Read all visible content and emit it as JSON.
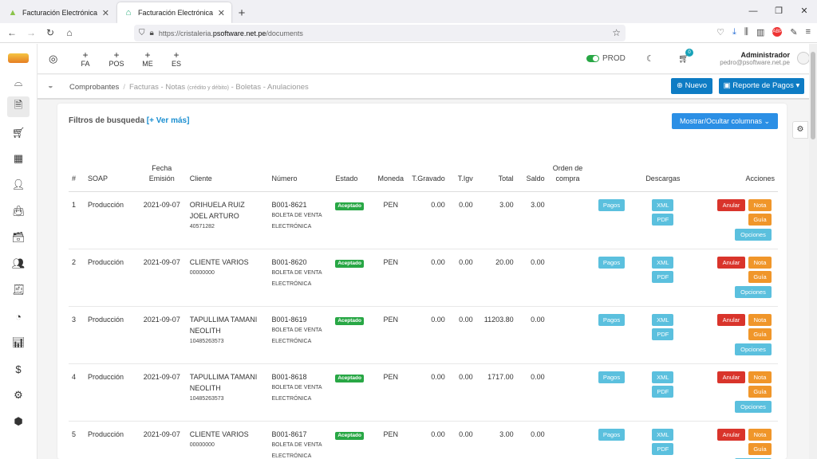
{
  "browser": {
    "tabs": [
      {
        "title": "Facturación Electrónica",
        "icon": "app-logo-icon",
        "active": false
      },
      {
        "title": "Facturación Electrónica",
        "icon": "app-logo-icon",
        "active": true
      }
    ],
    "url_prefix": "https://cristaleria.",
    "url_domain": "psoftware.net.pe",
    "url_path": "/documents"
  },
  "topbar": {
    "quick_actions": [
      {
        "plus": "+",
        "label": "FA"
      },
      {
        "plus": "+",
        "label": "POS"
      },
      {
        "plus": "+",
        "label": "ME"
      },
      {
        "plus": "+",
        "label": "ES"
      }
    ],
    "env_label": "PROD",
    "cart_count": "0",
    "user_name": "Administrador",
    "user_email": "pedro@psoftware.net.pe"
  },
  "breadcrumb": {
    "current": "Comprobantes",
    "sep": "/",
    "rest_a": "Facturas - Notas",
    "rest_small": "(crédito y débito)",
    "rest_b": "- Boletas - Anulaciones"
  },
  "buttons": {
    "nuevo": "Nuevo",
    "reporte": "Reporte de Pagos",
    "columnas": "Mostrar/Ocultar columnas"
  },
  "filters": {
    "title": "Filtros de busqueda",
    "more": "[+ Ver más]"
  },
  "table": {
    "headers": {
      "num": "#",
      "soap": "SOAP",
      "fecha_1": "Fecha",
      "fecha_2": "Emisión",
      "cliente": "Cliente",
      "numero": "Número",
      "estado": "Estado",
      "moneda": "Moneda",
      "gravado": "T.Gravado",
      "igv": "T.Igv",
      "total": "Total",
      "saldo": "Saldo",
      "orden_1": "Orden de",
      "orden_2": "compra",
      "descargas": "Descargas",
      "acciones": "Acciones"
    },
    "rows": [
      {
        "n": "1",
        "soap": "Producción",
        "fecha": "2021-09-07",
        "cliente_1": "ORIHUELA RUIZ",
        "cliente_2": "JOEL ARTURO",
        "doc": "40571282",
        "numero": "B001-8621",
        "tipo_1": "BOLETA DE VENTA",
        "tipo_2": "ELECTRÓNICA",
        "estado": "Aceptado",
        "moneda": "PEN",
        "gravado": "0.00",
        "igv": "0.00",
        "total": "3.00",
        "saldo": "3.00"
      },
      {
        "n": "2",
        "soap": "Producción",
        "fecha": "2021-09-07",
        "cliente_1": "CLIENTE VARIOS",
        "cliente_2": "",
        "doc": "00000000",
        "numero": "B001-8620",
        "tipo_1": "BOLETA DE VENTA",
        "tipo_2": "ELECTRÓNICA",
        "estado": "Aceptado",
        "moneda": "PEN",
        "gravado": "0.00",
        "igv": "0.00",
        "total": "20.00",
        "saldo": "0.00"
      },
      {
        "n": "3",
        "soap": "Producción",
        "fecha": "2021-09-07",
        "cliente_1": "TAPULLIMA TAMANI",
        "cliente_2": "NEOLITH",
        "doc": "10485263573",
        "numero": "B001-8619",
        "tipo_1": "BOLETA DE VENTA",
        "tipo_2": "ELECTRÓNICA",
        "estado": "Aceptado",
        "moneda": "PEN",
        "gravado": "0.00",
        "igv": "0.00",
        "total": "11203.80",
        "saldo": "0.00"
      },
      {
        "n": "4",
        "soap": "Producción",
        "fecha": "2021-09-07",
        "cliente_1": "TAPULLIMA TAMANI",
        "cliente_2": "NEOLITH",
        "doc": "10485263573",
        "numero": "B001-8618",
        "tipo_1": "BOLETA DE VENTA",
        "tipo_2": "ELECTRÓNICA",
        "estado": "Aceptado",
        "moneda": "PEN",
        "gravado": "0.00",
        "igv": "0.00",
        "total": "1717.00",
        "saldo": "0.00"
      },
      {
        "n": "5",
        "soap": "Producción",
        "fecha": "2021-09-07",
        "cliente_1": "CLIENTE VARIOS",
        "cliente_2": "",
        "doc": "00000000",
        "numero": "B001-8617",
        "tipo_1": "BOLETA DE VENTA",
        "tipo_2": "ELECTRÓNICA",
        "estado": "Aceptado",
        "moneda": "PEN",
        "gravado": "0.00",
        "igv": "0.00",
        "total": "3.00",
        "saldo": "0.00"
      }
    ],
    "row_buttons": {
      "pagos": "Pagos",
      "xml": "XML",
      "pdf": "PDF",
      "anular": "Anular",
      "nota": "Nota",
      "guia": "Guía",
      "opciones": "Opciones"
    }
  },
  "colors": {
    "primary": "#0e7cc4",
    "info": "#5bc0de",
    "success": "#28a745",
    "danger": "#d9342b",
    "warning": "#f0962a"
  }
}
